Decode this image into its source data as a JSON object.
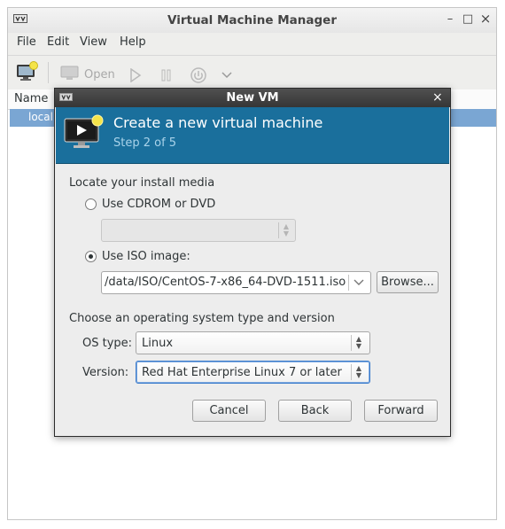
{
  "main_window": {
    "title": "Virtual Machine Manager",
    "menu": [
      "File",
      "Edit",
      "View",
      "Help"
    ],
    "toolbar": {
      "open_label": "Open"
    },
    "list": {
      "name_header": "Name",
      "row_text": "localh"
    }
  },
  "dialog": {
    "title": "New VM",
    "header": {
      "title": "Create a new virtual machine",
      "step": "Step 2 of 5"
    },
    "install_media": {
      "section_label": "Locate your install media",
      "cdrom_label": "Use CDROM or DVD",
      "cdrom_selected": false,
      "iso_label": "Use ISO image:",
      "iso_selected": true,
      "iso_path": "/data/ISO/CentOS-7-x86_64-DVD-1511.iso",
      "browse_label": "Browse..."
    },
    "os_section": {
      "section_label": "Choose an operating system type and version",
      "os_type_label": "OS type:",
      "os_type_value": "Linux",
      "version_label": "Version:",
      "version_value": "Red Hat Enterprise Linux 7 or later"
    },
    "buttons": {
      "cancel": "Cancel",
      "back": "Back",
      "forward": "Forward"
    }
  },
  "colors": {
    "banner": "#1a6f9c",
    "selection": "#7aa6d3",
    "focus": "#3d7dcc"
  },
  "icons": [
    "vmm-app-icon",
    "new-vm-icon",
    "monitor-icon",
    "play-icon",
    "pause-icon",
    "power-icon",
    "chevron-down-icon",
    "close-icon"
  ]
}
